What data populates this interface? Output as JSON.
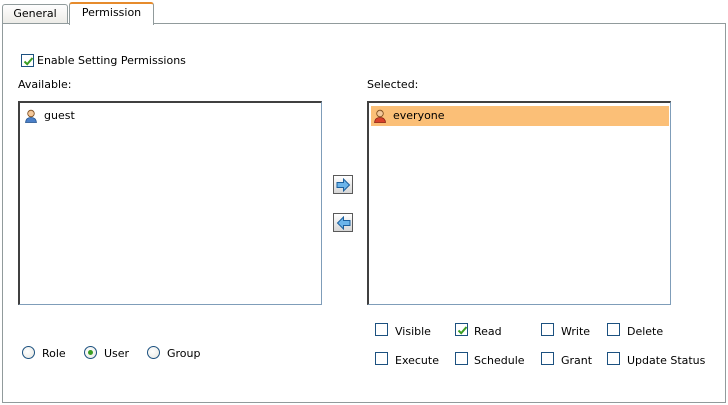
{
  "tabs": [
    {
      "label": "General"
    },
    {
      "label": "Permission"
    }
  ],
  "enable_permissions": {
    "label": "Enable Setting Permissions",
    "checked": true
  },
  "available": {
    "heading": "Available:",
    "items": [
      {
        "name": "guest",
        "icon": "user-icon"
      }
    ]
  },
  "selected": {
    "heading": "Selected:",
    "items": [
      {
        "name": "everyone",
        "icon": "role-icon",
        "highlighted": true
      }
    ]
  },
  "move_right_icon": "arrow-right-icon",
  "move_left_icon": "arrow-left-icon",
  "type_options": [
    {
      "label": "Role",
      "selected": false
    },
    {
      "label": "User",
      "selected": true
    },
    {
      "label": "Group",
      "selected": false
    }
  ],
  "permissions": [
    {
      "label": "Visible",
      "checked": false
    },
    {
      "label": "Read",
      "checked": true
    },
    {
      "label": "Write",
      "checked": false
    },
    {
      "label": "Delete",
      "checked": false
    },
    {
      "label": "Execute",
      "checked": false
    },
    {
      "label": "Schedule",
      "checked": false
    },
    {
      "label": "Grant",
      "checked": false
    },
    {
      "label": "Update Status",
      "checked": false
    }
  ],
  "colors": {
    "accent_tab": "#e68b2c",
    "selection": "#fbbf77",
    "check": "#3a9d23"
  }
}
